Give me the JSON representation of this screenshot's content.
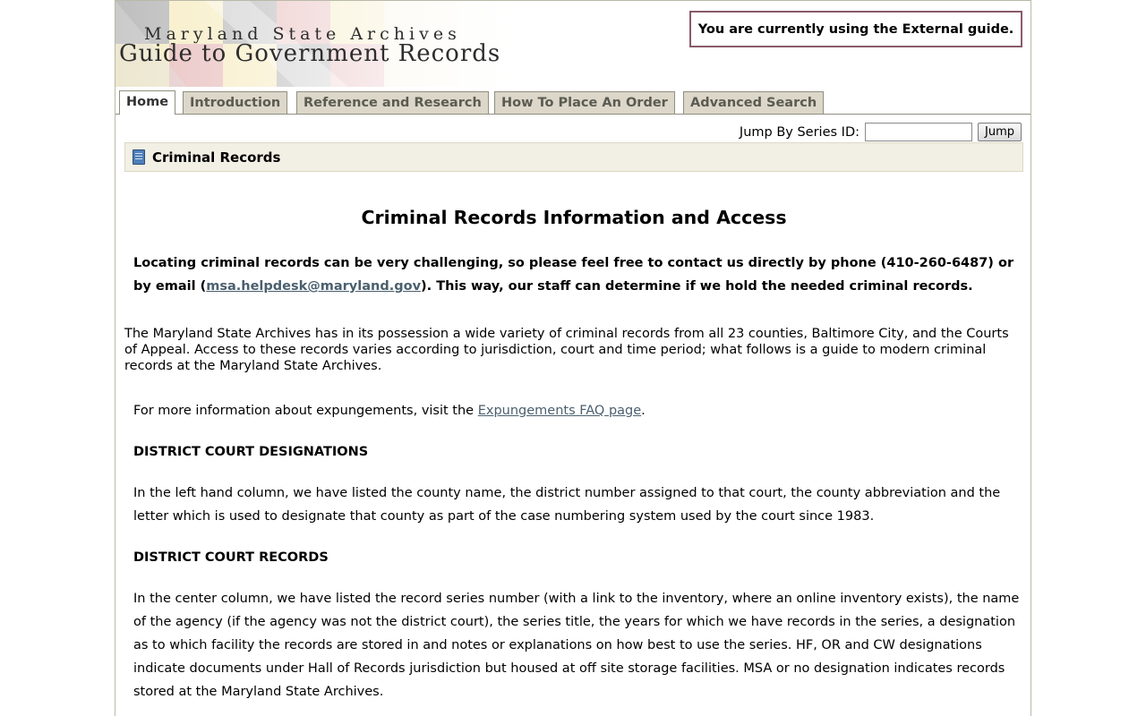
{
  "header": {
    "site_name": "Maryland State Archives",
    "site_title": "Guide to Government Records",
    "guide_notice": "You are currently using the External guide."
  },
  "tabs": [
    {
      "label": "Home",
      "active": true
    },
    {
      "label": "Introduction",
      "active": false
    },
    {
      "label": "Reference and Research",
      "active": false
    },
    {
      "label": "How To Place An Order",
      "active": false
    },
    {
      "label": "Advanced Search",
      "active": false
    }
  ],
  "jump": {
    "label": "Jump By Series ID:",
    "input_value": "",
    "button_label": "Jump"
  },
  "section": {
    "icon": "book-icon",
    "title": "Criminal Records"
  },
  "main": {
    "heading": "Criminal Records Information and Access",
    "notice_before": "Locating criminal records can be very challenging, so please feel free to contact us directly by phone (410-260-6487) or by email (",
    "notice_email": "msa.helpdesk@maryland.gov",
    "notice_after": "). This way, our staff can determine if we hold the needed criminal records.",
    "intro": "The Maryland State Archives has in its possession a wide variety of criminal records from all 23 counties, Baltimore City, and the Courts of Appeal. Access to these records varies according to jurisdiction, court and time period; what follows is a guide to modern criminal records at the Maryland State Archives.",
    "expunge_before": "For more information about expungements, visit the ",
    "expunge_link": "Expungements FAQ page",
    "expunge_after": ".",
    "designations_heading": "DISTRICT COURT DESIGNATIONS",
    "designations_text": "In the left hand column, we have listed the county name, the district number assigned to that court, the county abbreviation and the letter which is used to designate that county as part of the case numbering system used by the court since 1983.",
    "records_heading": "DISTRICT COURT RECORDS",
    "records_text": "In the center column, we have listed the record series number (with a link to the inventory, where an online inventory exists), the name of the agency (if the agency was not the district court), the series title, the years for which we have records in the series, a designation as to which facility the records are stored in and notes or explanations on how best to use the series. HF, OR and CW designations indicate documents under Hall of Records jurisdiction but housed at off site storage facilities. MSA or no designation indicates records stored at the Maryland State Archives."
  },
  "colors": {
    "tab_bg": "#dcd7c9",
    "section_bg": "#f2efe4",
    "notice_border": "#8a5a6a",
    "link": "#4a5f6e"
  }
}
